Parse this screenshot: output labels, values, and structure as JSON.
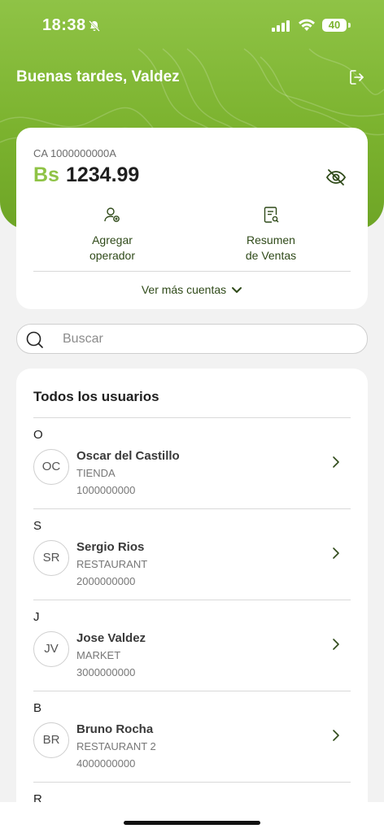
{
  "status_bar": {
    "time": "18:38",
    "battery": "40"
  },
  "header": {
    "greeting": "Buenas tardes, Valdez"
  },
  "account": {
    "id": "CA 1000000000A",
    "currency": "Bs",
    "balance": "1234.99",
    "actions": [
      {
        "label_line1": "Agregar",
        "label_line2": "operador",
        "icon": "add-user-icon"
      },
      {
        "label_line1": "Resumen",
        "label_line2": "de Ventas",
        "icon": "sales-summary-icon"
      }
    ],
    "more_accounts": "Ver más cuentas"
  },
  "search": {
    "placeholder": "Buscar"
  },
  "users": {
    "title": "Todos los usuarios",
    "groups": [
      {
        "letter": "O",
        "initials": "OC",
        "name": "Oscar del Castillo",
        "type": "TIENDA",
        "number": "1000000000"
      },
      {
        "letter": "S",
        "initials": "SR",
        "name": "Sergio Rios",
        "type": "RESTAURANT",
        "number": "2000000000"
      },
      {
        "letter": "J",
        "initials": "JV",
        "name": "Jose Valdez",
        "type": "MARKET",
        "number": "3000000000"
      },
      {
        "letter": "B",
        "initials": "BR",
        "name": "Bruno Rocha",
        "type": "RESTAURANT 2",
        "number": "4000000000"
      },
      {
        "letter": "R"
      }
    ]
  },
  "colors": {
    "brand_green": "#7cb32f",
    "currency_green": "#8fc346",
    "dark_green": "#2f4a19"
  }
}
